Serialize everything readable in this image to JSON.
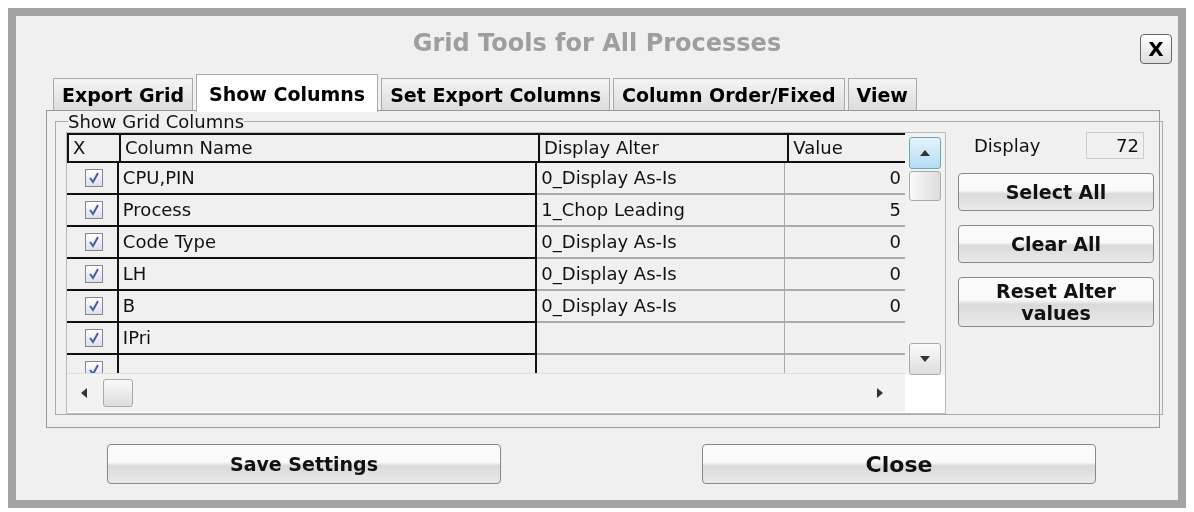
{
  "window": {
    "title": "Grid Tools for All Processes",
    "close_label": "X"
  },
  "tabs": [
    {
      "label": "Export Grid",
      "selected": false
    },
    {
      "label": "Show Columns",
      "selected": true
    },
    {
      "label": "Set Export Columns",
      "selected": false
    },
    {
      "label": "Column Order/Fixed",
      "selected": false
    },
    {
      "label": "View",
      "selected": false
    }
  ],
  "group": {
    "title": "Show Grid Columns"
  },
  "table": {
    "columns": [
      "X",
      "Column Name",
      "Display Alter",
      "Value"
    ],
    "rows": [
      {
        "checked": true,
        "name": "CPU,PIN",
        "display_alter": "0_Display As-Is",
        "value": "0"
      },
      {
        "checked": true,
        "name": "Process",
        "display_alter": "1_Chop Leading",
        "value": "5"
      },
      {
        "checked": true,
        "name": "Code Type",
        "display_alter": "0_Display As-Is",
        "value": "0"
      },
      {
        "checked": true,
        "name": "LH",
        "display_alter": "0_Display As-Is",
        "value": "0"
      },
      {
        "checked": true,
        "name": "B",
        "display_alter": "0_Display As-Is",
        "value": "0"
      },
      {
        "checked": true,
        "name": "IPri"
      },
      {
        "checked": true
      }
    ]
  },
  "display": {
    "label": "Display",
    "value": "72"
  },
  "side_buttons": [
    "Select All",
    "Clear All",
    "Reset Alter values"
  ],
  "bottom_buttons": [
    "Save Settings",
    "Close"
  ]
}
